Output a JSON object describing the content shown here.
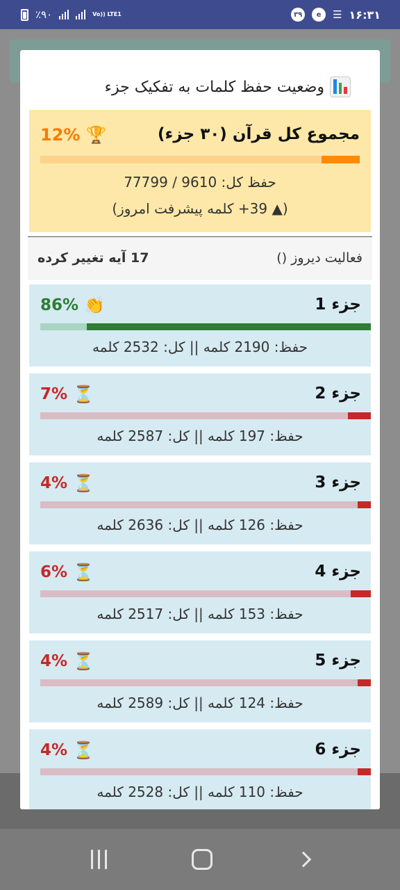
{
  "status_bar": {
    "battery": "٪۹۰",
    "volte": "Vo)) LTE1",
    "badge": "۳۹",
    "time": "۱۶:۳۱"
  },
  "dialog": {
    "title": "وضعیت حفظ کلمات به تفکیک جزء",
    "title_icon": "bar-chart-icon",
    "total": {
      "title": "مجموع کل قرآن (۳۰ جزء)",
      "percent_label": "12%",
      "percent": 12,
      "icon": "trophy-icon",
      "memorized_line": "حفظ کل: 9610 / 77799",
      "progress_line": "(▲ 39+ کلمه پیشرفت امروز)",
      "bar_color": "#ff8c00",
      "track_color": "#fdd28a"
    },
    "activity": {
      "label": "فعالیت دیروز ()",
      "value": "17 آیه تغییر کرده"
    },
    "juz_list": [
      {
        "name": "جزء 1",
        "percent_label": "86%",
        "percent": 86,
        "icon": "clapping-hands-icon",
        "stats": "حفظ: 2190 کلمه  ||  کل: 2532 کلمه",
        "pct_color": "#2e7d32",
        "bar_color": "#2e7d32",
        "track_color": "#a8d5c2"
      },
      {
        "name": "جزء 2",
        "percent_label": "7%",
        "percent": 7,
        "icon": "hourglass-icon",
        "stats": "حفظ: 197 کلمه  ||  کل: 2587 کلمه",
        "pct_color": "#c62828",
        "bar_color": "#c62828",
        "track_color": "#d9bcc4"
      },
      {
        "name": "جزء 3",
        "percent_label": "4%",
        "percent": 4,
        "icon": "hourglass-icon",
        "stats": "حفظ: 126 کلمه  ||  کل: 2636 کلمه",
        "pct_color": "#c62828",
        "bar_color": "#c62828",
        "track_color": "#d9bcc4"
      },
      {
        "name": "جزء 4",
        "percent_label": "6%",
        "percent": 6,
        "icon": "hourglass-icon",
        "stats": "حفظ: 153 کلمه  ||  کل: 2517 کلمه",
        "pct_color": "#c62828",
        "bar_color": "#c62828",
        "track_color": "#d9bcc4"
      },
      {
        "name": "جزء 5",
        "percent_label": "4%",
        "percent": 4,
        "icon": "hourglass-icon",
        "stats": "حفظ: 124 کلمه  ||  کل: 2589 کلمه",
        "pct_color": "#c62828",
        "bar_color": "#c62828",
        "track_color": "#d9bcc4"
      },
      {
        "name": "جزء 6",
        "percent_label": "4%",
        "percent": 4,
        "icon": "hourglass-icon",
        "stats": "حفظ: 110 کلمه  ||  کل: 2528 کلمه",
        "pct_color": "#c62828",
        "bar_color": "#c62828",
        "track_color": "#d9bcc4"
      }
    ]
  },
  "nav_bar": {
    "recent_icon": "recent-apps-icon",
    "home_icon": "home-icon",
    "back_icon": "back-icon"
  }
}
